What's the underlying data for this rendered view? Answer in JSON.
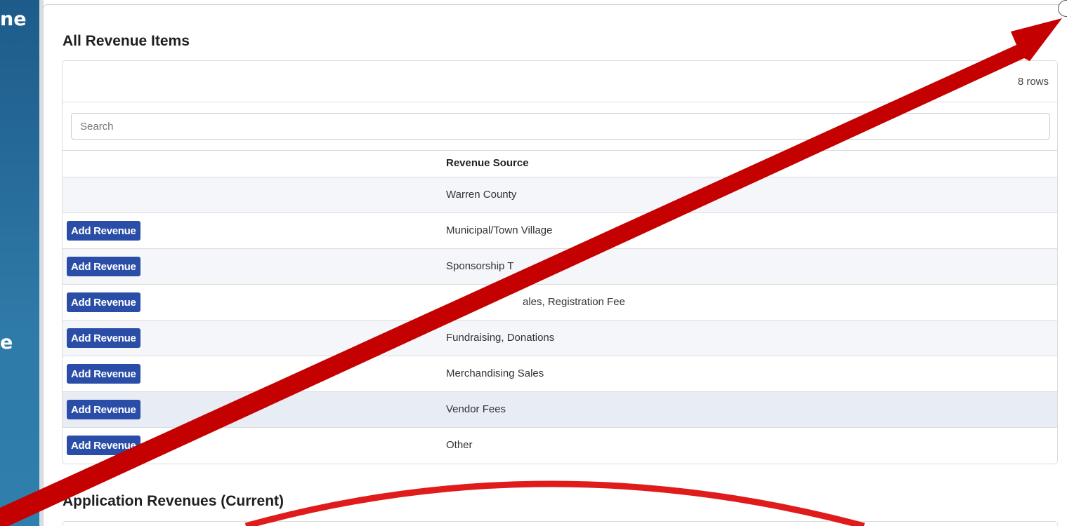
{
  "background_fragments": {
    "top": "ne",
    "middle": "e"
  },
  "section1": {
    "title": "All Revenue Items",
    "row_count": "8 rows",
    "search_placeholder": "Search",
    "column_header": "Revenue Source",
    "add_button_label": "Add Revenue",
    "rows": [
      {
        "source": "Warren County",
        "has_button": false
      },
      {
        "source": "Municipal/Town Village",
        "has_button": true
      },
      {
        "source": "Sponsorship T",
        "has_button": true
      },
      {
        "source": "ales, Registration Fee",
        "has_button": true
      },
      {
        "source": "Fundraising, Donations",
        "has_button": true
      },
      {
        "source": "Merchandising Sales",
        "has_button": true
      },
      {
        "source": "Vendor Fees",
        "has_button": true
      },
      {
        "source": "Other",
        "has_button": true
      }
    ]
  },
  "section2": {
    "title": "Application Revenues (Current)"
  },
  "annotation": {
    "arrow_color": "#c40000",
    "curve_color": "#e01b1b"
  }
}
